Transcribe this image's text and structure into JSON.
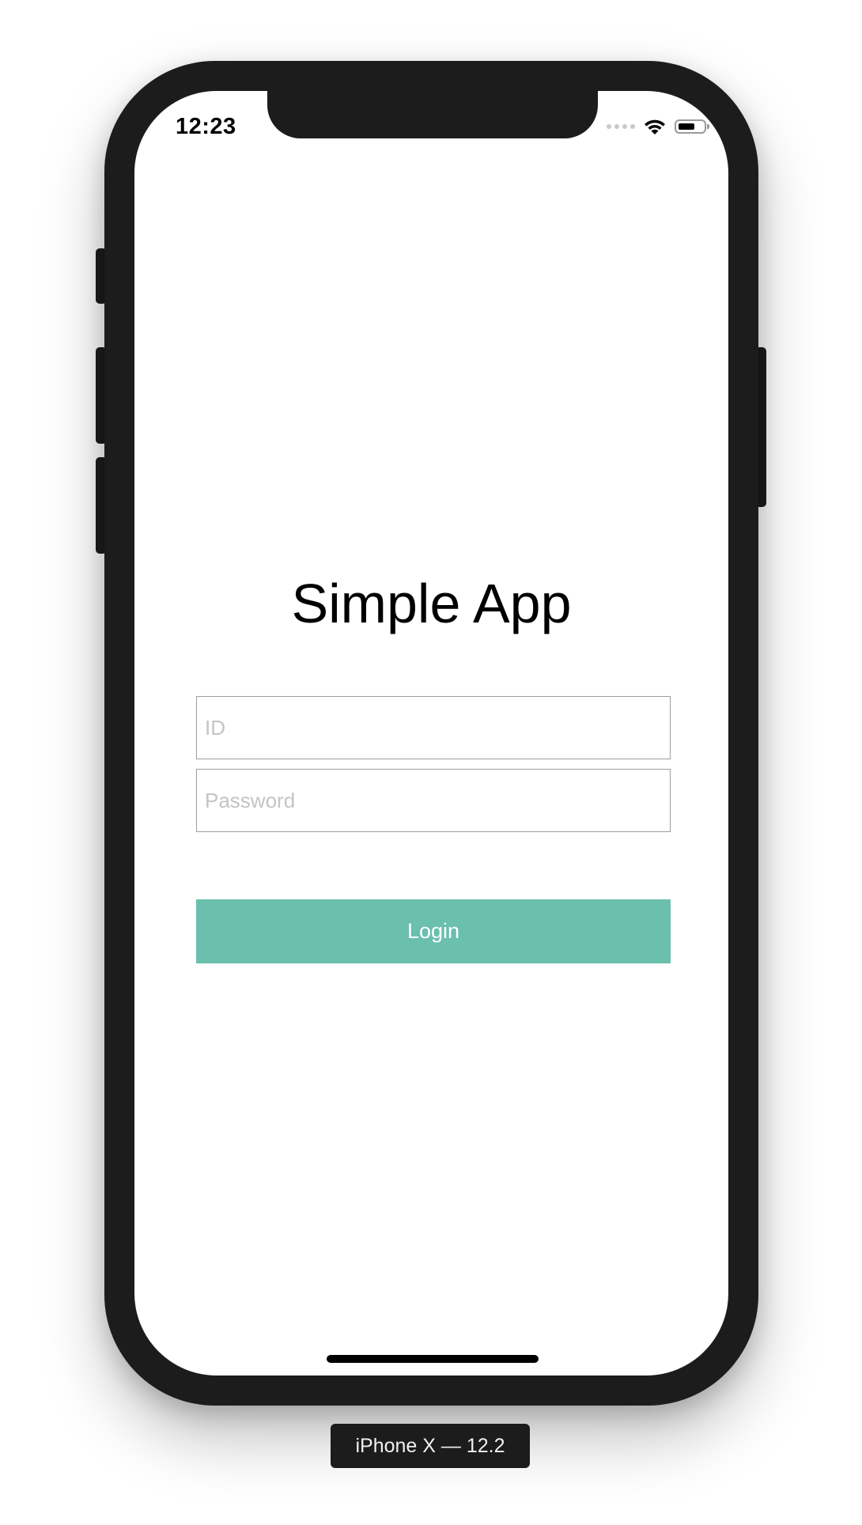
{
  "status_bar": {
    "time": "12:23"
  },
  "app": {
    "title": "Simple App",
    "id_field": {
      "placeholder": "ID",
      "value": ""
    },
    "password_field": {
      "placeholder": "Password",
      "value": ""
    },
    "login_label": "Login"
  },
  "device": {
    "label": "iPhone X — 12.2"
  },
  "colors": {
    "accent": "#6abfad",
    "frame": "#1c1c1c"
  },
  "icons": {
    "signal": "cellular-signal-icon",
    "wifi": "wifi-icon",
    "battery": "battery-icon"
  }
}
